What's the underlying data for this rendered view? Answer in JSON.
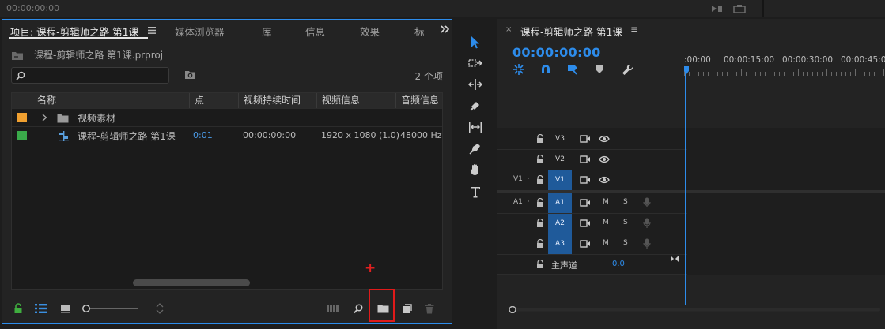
{
  "top": {
    "timecode": "00:00:00:00"
  },
  "project_panel": {
    "tabs": [
      {
        "label": "项目: 课程-剪辑师之路 第1课",
        "active": true
      },
      {
        "label": "媒体浏览器"
      },
      {
        "label": "库"
      },
      {
        "label": "信息"
      },
      {
        "label": "效果"
      },
      {
        "label": "标"
      }
    ],
    "menu_icon": "hamburger-menu-icon",
    "overflow_icon": "double-chevron-right-icon",
    "project_file": "课程-剪辑师之路 第1课.prproj",
    "search": {
      "value": "",
      "placeholder": ""
    },
    "item_count": "2 个项",
    "columns": [
      "名称",
      "点",
      "视频持续时间",
      "视频信息",
      "音频信息"
    ],
    "rows": [
      {
        "label_color": "#f0a030",
        "name": "视频素材",
        "type": "folder",
        "in_point": "",
        "duration": "",
        "video_info": "",
        "audio_info": ""
      },
      {
        "label_color": "#3aaa4a",
        "name": "课程-剪辑师之路 第1课",
        "type": "sequence",
        "in_point": "0:01",
        "duration": "00:00:00:00",
        "video_info": "1920 x 1080 (1.0)",
        "audio_info": "48000 Hz -"
      }
    ],
    "footer_icons": [
      "lock-icon",
      "list-view-icon",
      "icon-view-icon",
      "zoom-slider",
      "sort-icon",
      "automate-to-sequence-icon",
      "find-icon",
      "new-bin-icon",
      "new-item-icon",
      "trash-icon"
    ],
    "annotation_mark": "+"
  },
  "tools": [
    "selection-tool-icon",
    "track-select-tool-icon",
    "ripple-edit-tool-icon",
    "razor-tool-icon",
    "slip-tool-icon",
    "pen-tool-icon",
    "hand-tool-icon",
    "type-tool-icon"
  ],
  "timeline": {
    "close": "×",
    "title": "课程-剪辑师之路 第1课",
    "menu": "≡",
    "timecode": "00:00:00:00",
    "ruler_labels": [
      ":00:00",
      "00:00:15:00",
      "00:00:30:00",
      "00:00:45:00"
    ],
    "video_tracks": [
      {
        "source": "",
        "name": "V3",
        "targeted": false
      },
      {
        "source": "",
        "name": "V2",
        "targeted": false
      },
      {
        "source": "V1",
        "name": "V1",
        "targeted": true
      }
    ],
    "audio_tracks": [
      {
        "source": "A1",
        "name": "A1",
        "m": "M",
        "s": "S"
      },
      {
        "source": "",
        "name": "A2",
        "m": "M",
        "s": "S"
      },
      {
        "source": "",
        "name": "A3",
        "m": "M",
        "s": "S"
      }
    ],
    "master": {
      "label": "主声道",
      "value": "0.0"
    }
  },
  "colors": {
    "accent": "#2d8ceb",
    "highlight_red": "#e01a1a",
    "track_target": "#1f5a9a"
  }
}
